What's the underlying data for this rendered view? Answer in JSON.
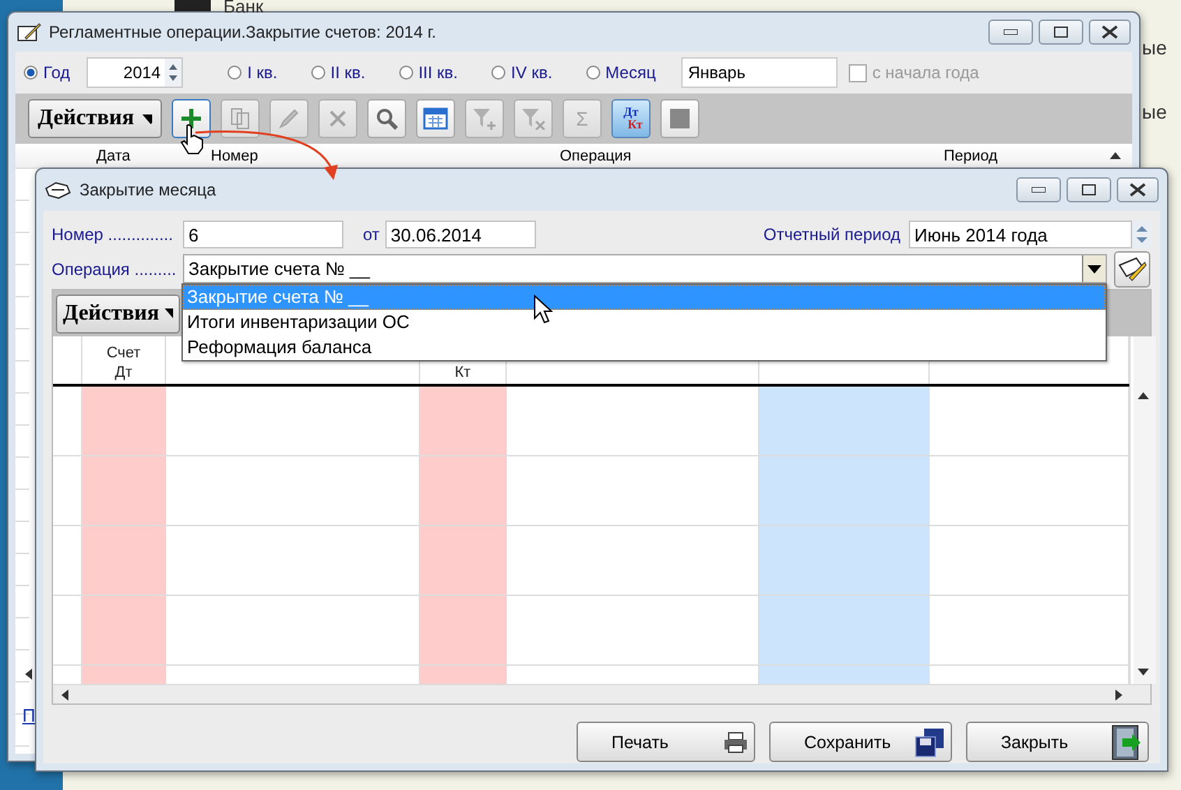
{
  "desktop": {
    "fragments": [
      "Банк",
      "ые",
      "ые"
    ],
    "link": "П"
  },
  "back_window": {
    "title": "Регламентные операции.Закрытие счетов: 2014 г.",
    "period_options": [
      {
        "label": "Год",
        "selected": true
      },
      {
        "label": "I кв.",
        "selected": false
      },
      {
        "label": "II кв.",
        "selected": false
      },
      {
        "label": "III кв.",
        "selected": false
      },
      {
        "label": "IV кв.",
        "selected": false
      },
      {
        "label": "Месяц",
        "selected": false
      }
    ],
    "year": "2014",
    "month": "Январь",
    "from_year_start": {
      "label": "с начала года",
      "checked": false,
      "disabled": true
    },
    "actions_label": "Действия",
    "toolbar": [
      {
        "kind": "add",
        "disabled": false
      },
      {
        "kind": "copy",
        "disabled": true
      },
      {
        "kind": "edit",
        "disabled": true
      },
      {
        "kind": "delete",
        "disabled": true
      },
      {
        "kind": "search",
        "disabled": false
      },
      {
        "kind": "calendar",
        "disabled": false
      },
      {
        "kind": "filter-add",
        "disabled": true
      },
      {
        "kind": "filter-clear",
        "disabled": true
      },
      {
        "kind": "sum",
        "disabled": true,
        "label": "Σ"
      },
      {
        "kind": "debit-credit",
        "disabled": false,
        "pressed": true,
        "label": "Дт",
        "label2": "Кт"
      },
      {
        "kind": "square",
        "disabled": false
      }
    ],
    "columns": [
      "Дата",
      "Номер",
      "Операция",
      "Период"
    ]
  },
  "front_window": {
    "title": "Закрытие месяца",
    "number_label": "Номер ..............",
    "number": "6",
    "date_label": "от",
    "date": "30.06.2014",
    "period_label": "Отчетный период",
    "period": "Июнь 2014 года",
    "operation_label": "Операция .........",
    "operation": "Закрытие счета № __",
    "dropdown": [
      {
        "label": "Закрытие счета № __",
        "selected": true
      },
      {
        "label": "Итоги инвентаризации ОС",
        "selected": false
      },
      {
        "label": "Реформация баланса",
        "selected": false
      }
    ],
    "actions_label": "Действия",
    "columns": [
      {
        "kind": "tinted",
        "lines": [
          "Счет",
          "Дт"
        ],
        "color": "#ffcccc"
      },
      {
        "kind": "plain"
      },
      {
        "kind": "tinted",
        "lines": [
          "Кт"
        ],
        "color": "#ffcccc"
      },
      {
        "kind": "plain"
      },
      {
        "kind": "tinted",
        "color": "#cce4fc"
      },
      {
        "kind": "plain"
      }
    ],
    "buttons": [
      {
        "kind": "print",
        "label": "Печать"
      },
      {
        "kind": "save",
        "label": "Сохранить"
      },
      {
        "kind": "close",
        "label": "Закрыть"
      }
    ]
  }
}
